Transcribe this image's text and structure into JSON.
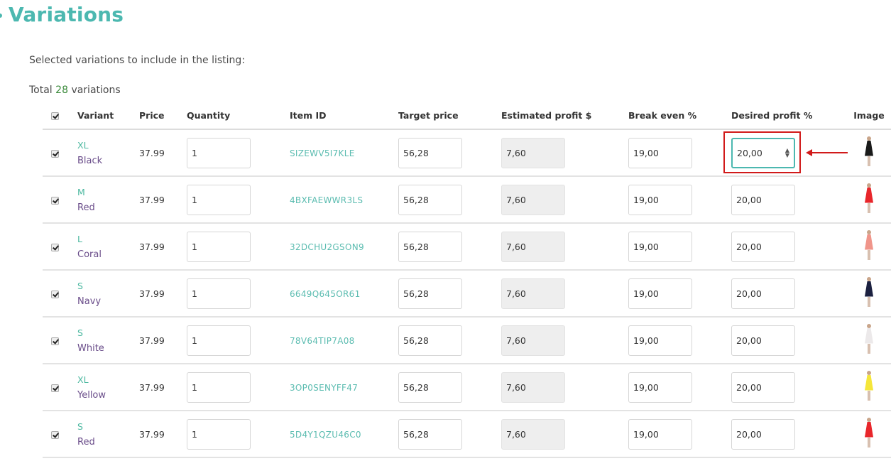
{
  "section": {
    "title": "Variations",
    "subtitle": "Selected variations to include in the listing:",
    "total_prefix": "Total",
    "total_count": "28",
    "total_suffix": "variations"
  },
  "table": {
    "headers": {
      "variant": "Variant",
      "price": "Price",
      "quantity": "Quantity",
      "item_id": "Item ID",
      "target_price": "Target price",
      "estimated_profit": "Estimated profit $",
      "break_even": "Break even %",
      "desired_profit": "Desired profit %",
      "image": "Image"
    },
    "select_all_checked": true,
    "rows": [
      {
        "checked": true,
        "size": "XL",
        "color": "Black",
        "price": "37.99",
        "quantity": "1",
        "item_id": "SIZEWV5I7KLE",
        "target_price": "56,28",
        "estimated_profit": "7,60",
        "break_even": "19,00",
        "desired_profit": "20,00",
        "dress_color": "#1a1a1a"
      },
      {
        "checked": true,
        "size": "M",
        "color": "Red",
        "price": "37.99",
        "quantity": "1",
        "item_id": "4BXFAEWWR3LS",
        "target_price": "56,28",
        "estimated_profit": "7,60",
        "break_even": "19,00",
        "desired_profit": "20,00",
        "dress_color": "#e8262b"
      },
      {
        "checked": true,
        "size": "L",
        "color": "Coral",
        "price": "37.99",
        "quantity": "1",
        "item_id": "32DCHU2GSON9",
        "target_price": "56,28",
        "estimated_profit": "7,60",
        "break_even": "19,00",
        "desired_profit": "20,00",
        "dress_color": "#f0958a"
      },
      {
        "checked": true,
        "size": "S",
        "color": "Navy",
        "price": "37.99",
        "quantity": "1",
        "item_id": "6649Q645OR61",
        "target_price": "56,28",
        "estimated_profit": "7,60",
        "break_even": "19,00",
        "desired_profit": "20,00",
        "dress_color": "#1c2140"
      },
      {
        "checked": true,
        "size": "S",
        "color": "White",
        "price": "37.99",
        "quantity": "1",
        "item_id": "78V64TIP7A08",
        "target_price": "56,28",
        "estimated_profit": "7,60",
        "break_even": "19,00",
        "desired_profit": "20,00",
        "dress_color": "#ece9ea"
      },
      {
        "checked": true,
        "size": "XL",
        "color": "Yellow",
        "price": "37.99",
        "quantity": "1",
        "item_id": "3OP0SENYFF47",
        "target_price": "56,28",
        "estimated_profit": "7,60",
        "break_even": "19,00",
        "desired_profit": "20,00",
        "dress_color": "#f5e63a"
      },
      {
        "checked": true,
        "size": "S",
        "color": "Red",
        "price": "37.99",
        "quantity": "1",
        "item_id": "5D4Y1QZU46C0",
        "target_price": "56,28",
        "estimated_profit": "7,60",
        "break_even": "19,00",
        "desired_profit": "20,00",
        "dress_color": "#e8262b"
      }
    ]
  },
  "annotation": {
    "highlighted_field": "desired_profit",
    "highlighted_row": 0,
    "highlight_color": "#d11a1a"
  },
  "colors": {
    "accent": "#4cb8b0",
    "variant_color_text": "#6a4d8a",
    "count_text": "#3a8a3a"
  }
}
